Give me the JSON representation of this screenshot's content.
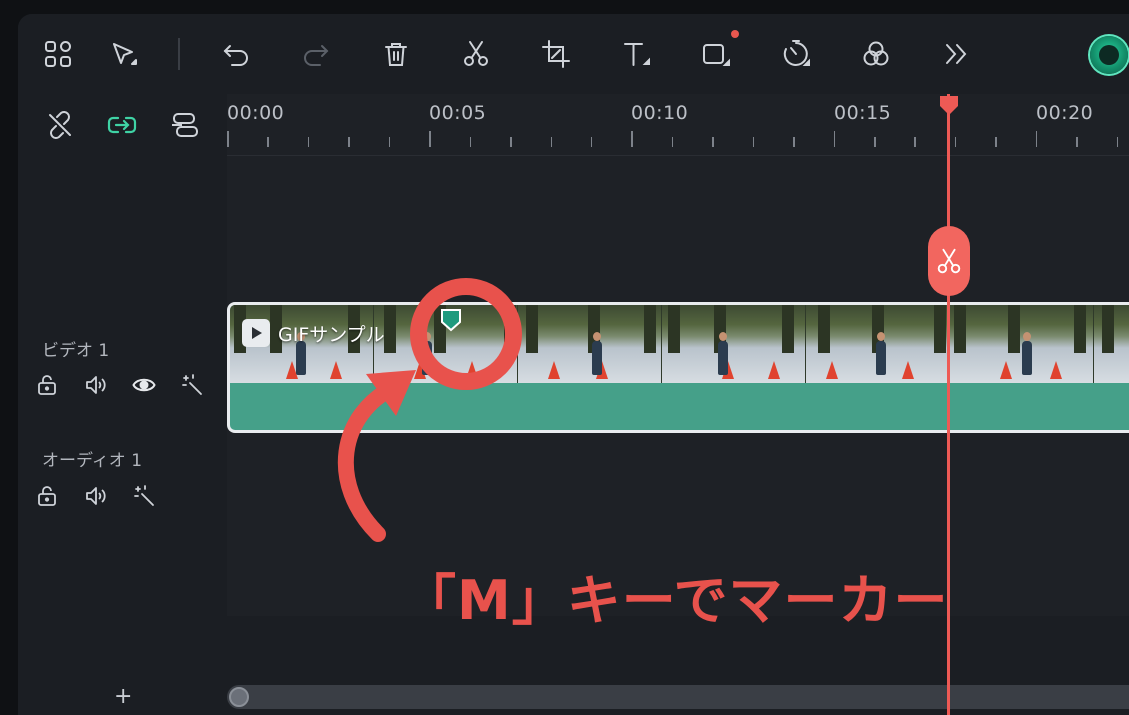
{
  "timeline": {
    "ruler_labels": [
      "00:00",
      "00:05",
      "00:10",
      "00:15",
      "00:20"
    ]
  },
  "tracks": {
    "video1": {
      "name": "ビデオ 1"
    },
    "audio1": {
      "name": "オーディオ 1"
    }
  },
  "clip": {
    "title": "GIFサンプル"
  },
  "annotation": {
    "text": "「M」キーでマーカー"
  },
  "add_track_label": "+",
  "colors": {
    "accent_red": "#e8524c",
    "playhead": "#ee5a55",
    "clip_green": "#45a089",
    "marker_green": "#1f9b7e",
    "active_icon_green": "#3fd3a5"
  },
  "icons": {
    "toolbar": [
      "grid-layout-icon",
      "select-arrow-icon",
      "undo-icon",
      "redo-icon",
      "delete-icon",
      "scissors-icon",
      "crop-icon",
      "text-icon",
      "shape-icon",
      "speed-icon",
      "color-match-icon",
      "more-icon"
    ],
    "timeline_tools": [
      "unlink-icon",
      "link-icon",
      "group-icon"
    ]
  }
}
